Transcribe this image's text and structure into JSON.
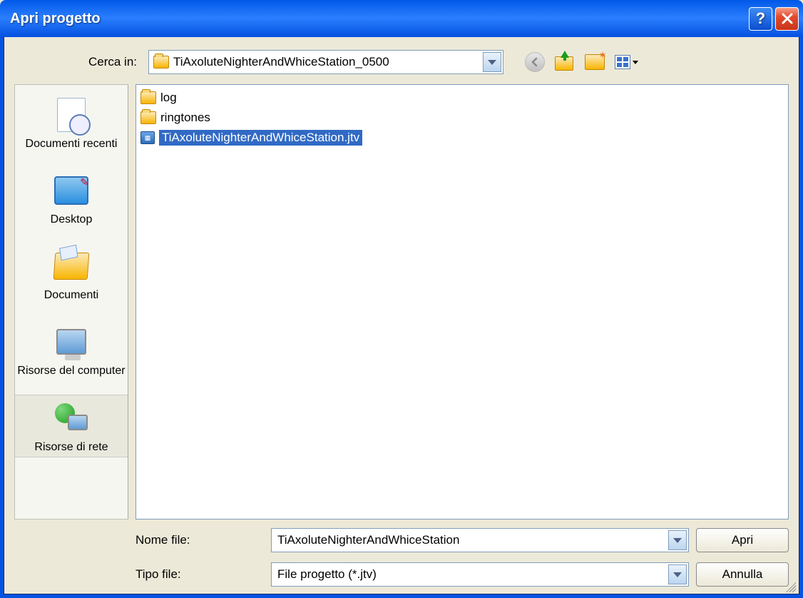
{
  "title": "Apri progetto",
  "labels": {
    "look_in": "Cerca in:",
    "filename": "Nome file:",
    "filetype": "Tipo file:"
  },
  "lookin": {
    "value": "TiAxoluteNighterAndWhiceStation_0500"
  },
  "places": [
    {
      "key": "recent",
      "label": "Documenti recenti"
    },
    {
      "key": "desktop",
      "label": "Desktop"
    },
    {
      "key": "documents",
      "label": "Documenti"
    },
    {
      "key": "mycomputer",
      "label": "Risorse del computer"
    },
    {
      "key": "network",
      "label": "Risorse di rete"
    }
  ],
  "files": [
    {
      "name": "log",
      "type": "folder",
      "selected": false
    },
    {
      "name": "ringtones",
      "type": "folder",
      "selected": false
    },
    {
      "name": "TiAxoluteNighterAndWhiceStation.jtv",
      "type": "file",
      "selected": true
    }
  ],
  "filename_value": "TiAxoluteNighterAndWhiceStation",
  "filetype_value": "File progetto (*.jtv)",
  "buttons": {
    "open": "Apri",
    "cancel": "Annulla"
  }
}
